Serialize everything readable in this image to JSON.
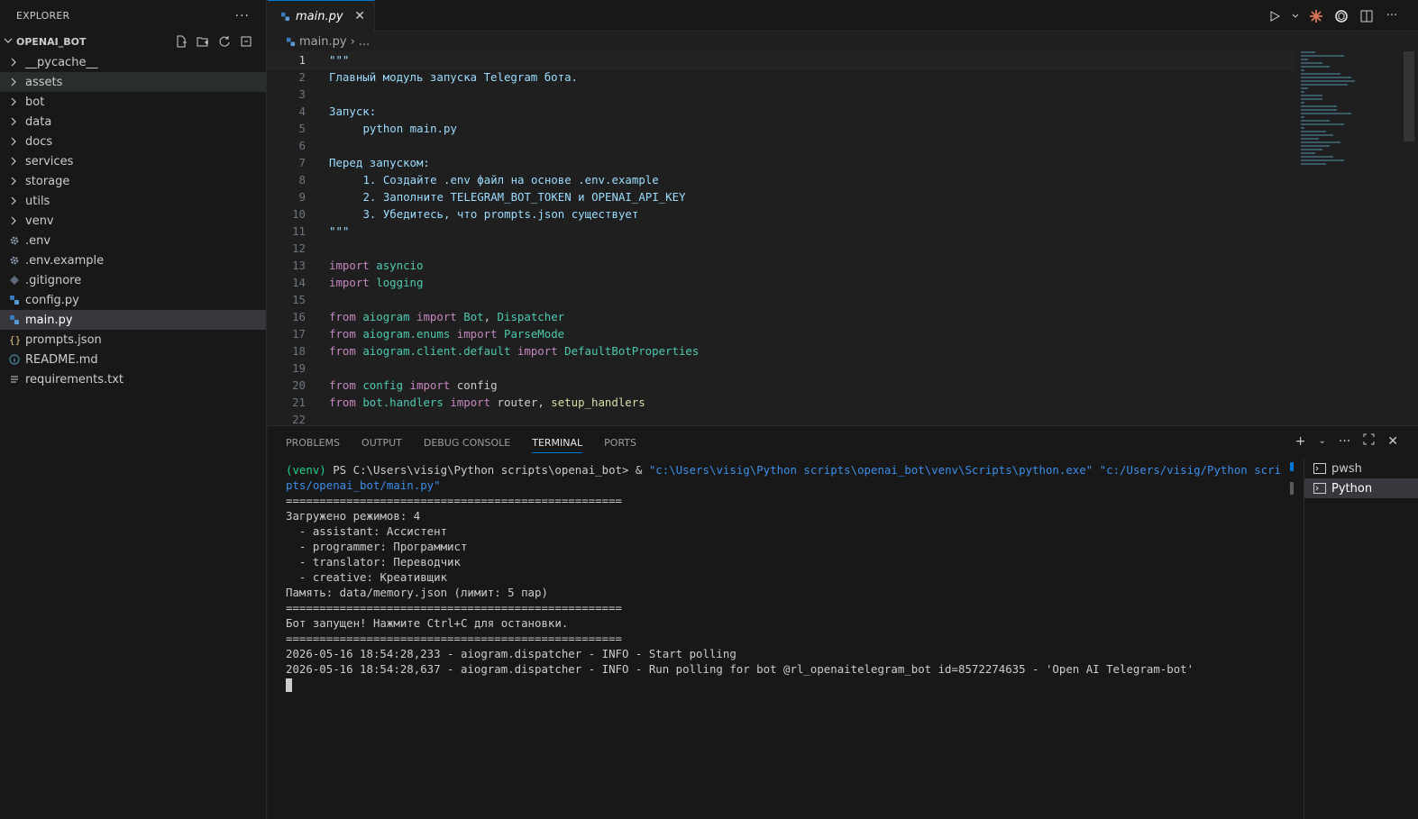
{
  "sidebar": {
    "title": "EXPLORER",
    "more_label": "···",
    "folder_name": "OPENAI_BOT",
    "items": [
      {
        "label": "__pycache__",
        "kind": "folder",
        "icon": "chevron-right-icon"
      },
      {
        "label": "assets",
        "kind": "folder",
        "icon": "chevron-right-icon"
      },
      {
        "label": "bot",
        "kind": "folder",
        "icon": "chevron-right-icon"
      },
      {
        "label": "data",
        "kind": "folder",
        "icon": "chevron-right-icon"
      },
      {
        "label": "docs",
        "kind": "folder",
        "icon": "chevron-right-icon"
      },
      {
        "label": "services",
        "kind": "folder",
        "icon": "chevron-right-icon"
      },
      {
        "label": "storage",
        "kind": "folder",
        "icon": "chevron-right-icon"
      },
      {
        "label": "utils",
        "kind": "folder",
        "icon": "chevron-right-icon"
      },
      {
        "label": "venv",
        "kind": "folder",
        "icon": "chevron-right-icon"
      },
      {
        "label": ".env",
        "kind": "file",
        "icon": "gear-icon"
      },
      {
        "label": ".env.example",
        "kind": "file",
        "icon": "gear-icon"
      },
      {
        "label": ".gitignore",
        "kind": "file",
        "icon": "git-icon"
      },
      {
        "label": "config.py",
        "kind": "file",
        "icon": "python-icon"
      },
      {
        "label": "main.py",
        "kind": "file",
        "icon": "python-icon"
      },
      {
        "label": "prompts.json",
        "kind": "file",
        "icon": "json-icon"
      },
      {
        "label": "README.md",
        "kind": "file",
        "icon": "info-icon"
      },
      {
        "label": "requirements.txt",
        "kind": "file",
        "icon": "lines-icon"
      }
    ]
  },
  "editor": {
    "tab_label": "main.py",
    "breadcrumb_file": "main.py",
    "breadcrumb_more": "...",
    "lines": [
      {
        "n": "1",
        "text": "\"\"\""
      },
      {
        "n": "2",
        "text": "Главный модуль запуска Telegram бота."
      },
      {
        "n": "3",
        "text": ""
      },
      {
        "n": "4",
        "text": "Запуск:"
      },
      {
        "n": "5",
        "text": "python main.py"
      },
      {
        "n": "6",
        "text": ""
      },
      {
        "n": "7",
        "text": "Перед запуском:"
      },
      {
        "n": "8",
        "text": "1. Создайте .env файл на основе .env.example"
      },
      {
        "n": "9",
        "text": "2. Заполните TELEGRAM_BOT_TOKEN и OPENAI_API_KEY"
      },
      {
        "n": "10",
        "text": "3. Убедитесь, что prompts.json существует"
      },
      {
        "n": "11",
        "text": "\"\"\""
      },
      {
        "n": "12",
        "text": ""
      },
      {
        "n": "13",
        "text": "import asyncio"
      },
      {
        "n": "14",
        "text": "import logging"
      },
      {
        "n": "15",
        "text": ""
      },
      {
        "n": "16",
        "text": "from aiogram import Bot, Dispatcher"
      },
      {
        "n": "17",
        "text": "from aiogram.enums import ParseMode"
      },
      {
        "n": "18",
        "text": "from aiogram.client.default import DefaultBotProperties"
      },
      {
        "n": "19",
        "text": ""
      },
      {
        "n": "20",
        "text": "from config import config"
      },
      {
        "n": "21",
        "text": "from bot.handlers import router, setup_handlers"
      },
      {
        "n": "22",
        "text": ""
      }
    ]
  },
  "panel": {
    "tabs": [
      "PROBLEMS",
      "OUTPUT",
      "DEBUG CONSOLE",
      "TERMINAL",
      "PORTS"
    ],
    "active_tab": "TERMINAL",
    "terminal_sessions": [
      "pwsh",
      "Python"
    ],
    "terminal": {
      "prompt_venv": "(venv)",
      "prompt_path": " PS C:\\Users\\visig\\Python scripts\\openai_bot> & ",
      "prompt_cmd": "\"c:\\Users\\visig\\Python scripts\\openai_bot\\venv\\Scripts\\python.exe\" \"c:/Users/visig/Python scripts/openai_bot/main.py\"",
      "output": [
        "==================================================",
        "Загружено режимов: 4",
        "  - assistant: Ассистент",
        "  - programmer: Программист",
        "  - translator: Переводчик",
        "  - creative: Креативщик",
        "Память: data/memory.json (лимит: 5 пар)",
        "==================================================",
        "Бот запущен! Нажмите Ctrl+C для остановки.",
        "==================================================",
        "2026-05-16 18:54:28,233 - aiogram.dispatcher - INFO - Start polling",
        "2026-05-16 18:54:28,637 - aiogram.dispatcher - INFO - Run polling for bot @rl_openaitelegram_bot id=8572274635 - 'Open AI Telegram-bot'"
      ]
    }
  }
}
